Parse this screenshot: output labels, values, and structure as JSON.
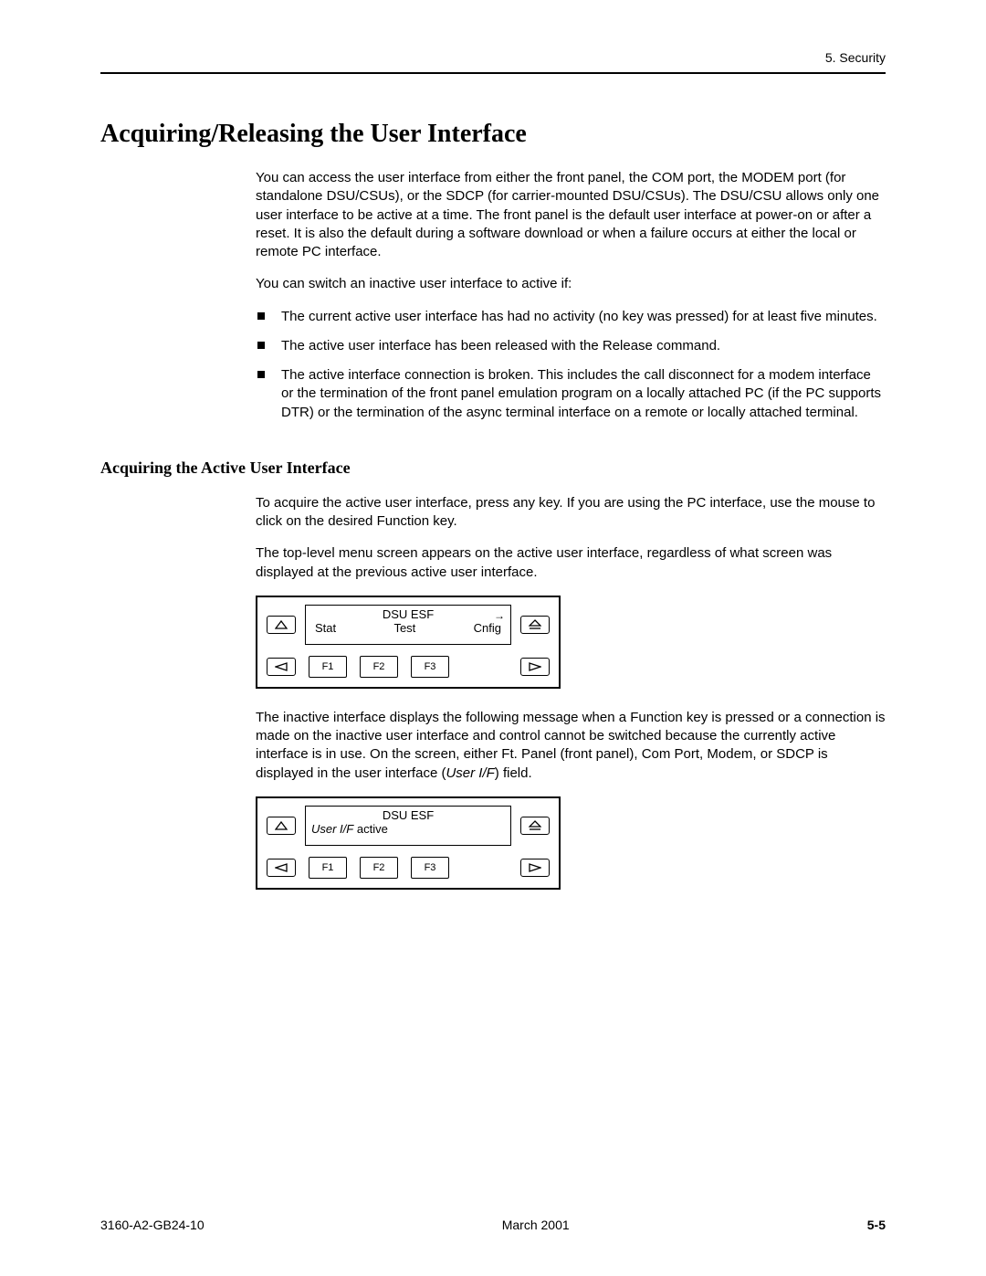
{
  "header": {
    "section": "5. Security"
  },
  "h1": "Acquiring/Releasing the User Interface",
  "intro_p1": "You can access the user interface from either the front panel, the COM port, the MODEM port (for standalone DSU/CSUs), or the SDCP (for carrier-mounted DSU/CSUs). The DSU/CSU allows only one user interface to be active at a time. The front panel is the default user interface at power-on or after a reset. It is also the default during a software download or when a failure occurs at either the local or remote PC interface.",
  "intro_p2": "You can switch an inactive user interface to active if:",
  "bullets": [
    "The current active user interface has had no activity (no key was pressed) for at least five minutes.",
    "The active user interface has been released with the Release command.",
    "The active interface connection is broken. This includes the call disconnect for a modem interface or the termination of the front panel emulation program on a locally attached PC (if the PC supports DTR) or the termination of the async terminal interface on a remote or locally attached terminal."
  ],
  "h2": "Acquiring the Active User Interface",
  "acq_p1": "To acquire the active user interface, press any key. If you are using the PC interface, use the mouse to click on the desired Function key.",
  "acq_p2": "The top-level menu screen appears on the active user interface, regardless of what screen was displayed at the previous active user interface.",
  "panel1": {
    "title": "DSU ESF",
    "menu": [
      "Stat",
      "Test",
      "Cnfig"
    ],
    "f": [
      "F1",
      "F2",
      "F3"
    ]
  },
  "acq_p3_pre": "The inactive interface displays the following message when a Function key is pressed or a connection is made on the inactive user interface and control cannot be switched because the currently active interface is in use. On the screen, either Ft. Panel (front panel), Com Port, Modem, or SDCP is displayed in the user interface (",
  "acq_p3_italic": "User I/F",
  "acq_p3_post": ") field.",
  "panel2": {
    "title": "DSU ESF",
    "line2_italic": "User I/F",
    "line2_rest": " active",
    "f": [
      "F1",
      "F2",
      "F3"
    ]
  },
  "footer": {
    "doc": "3160-A2-GB24-10",
    "date": "March 2001",
    "page": "5-5"
  }
}
